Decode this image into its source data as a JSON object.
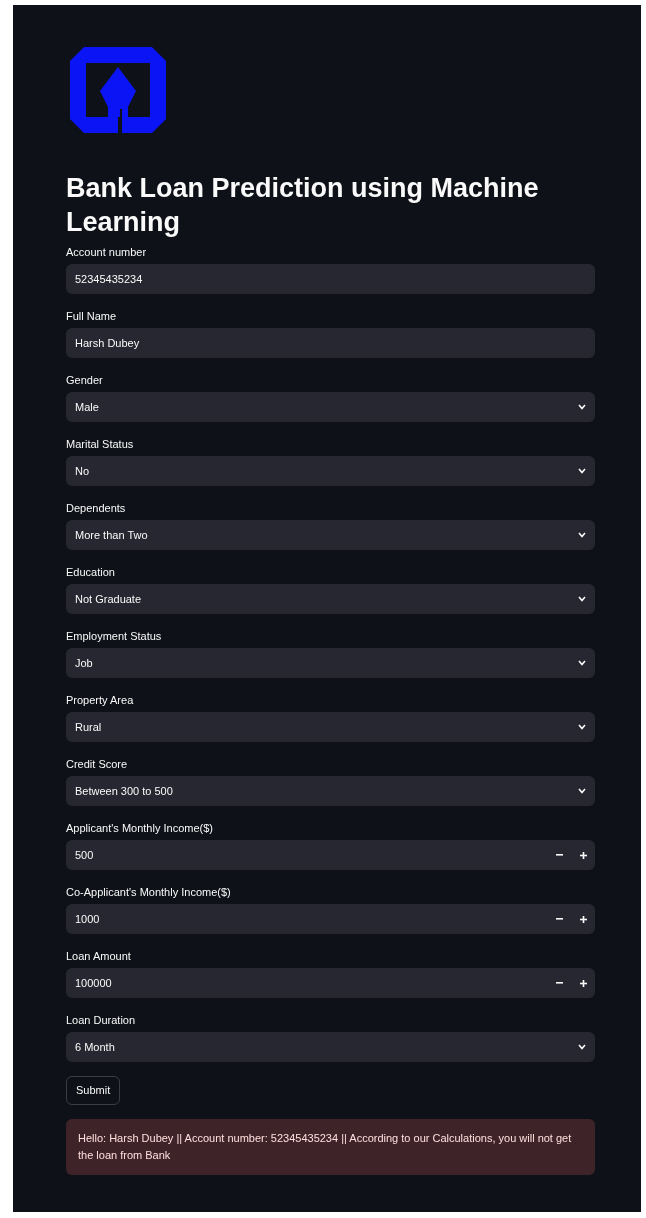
{
  "title": "Bank Loan Prediction using Machine Learning",
  "fields": [
    {
      "label": "Account number",
      "kind": "text",
      "value": "52345435234"
    },
    {
      "label": "Full Name",
      "kind": "text",
      "value": "Harsh Dubey"
    },
    {
      "label": "Gender",
      "kind": "select",
      "value": "Male"
    },
    {
      "label": "Marital Status",
      "kind": "select",
      "value": "No"
    },
    {
      "label": "Dependents",
      "kind": "select",
      "value": "More than Two"
    },
    {
      "label": "Education",
      "kind": "select",
      "value": "Not Graduate"
    },
    {
      "label": "Employment Status",
      "kind": "select",
      "value": "Job"
    },
    {
      "label": "Property Area",
      "kind": "select",
      "value": "Rural"
    },
    {
      "label": "Credit Score",
      "kind": "select",
      "value": "Between 300 to 500"
    },
    {
      "label": "Applicant's Monthly Income($)",
      "kind": "number",
      "value": "500"
    },
    {
      "label": "Co-Applicant's Monthly Income($)",
      "kind": "number",
      "value": "1000"
    },
    {
      "label": "Loan Amount",
      "kind": "number",
      "value": "100000"
    },
    {
      "label": "Loan Duration",
      "kind": "select",
      "value": "6 Month"
    }
  ],
  "submit": "Submit",
  "result": "Hello: Harsh Dubey || Account number: 52345435234 || According to our Calculations, you will not get the loan from Bank"
}
